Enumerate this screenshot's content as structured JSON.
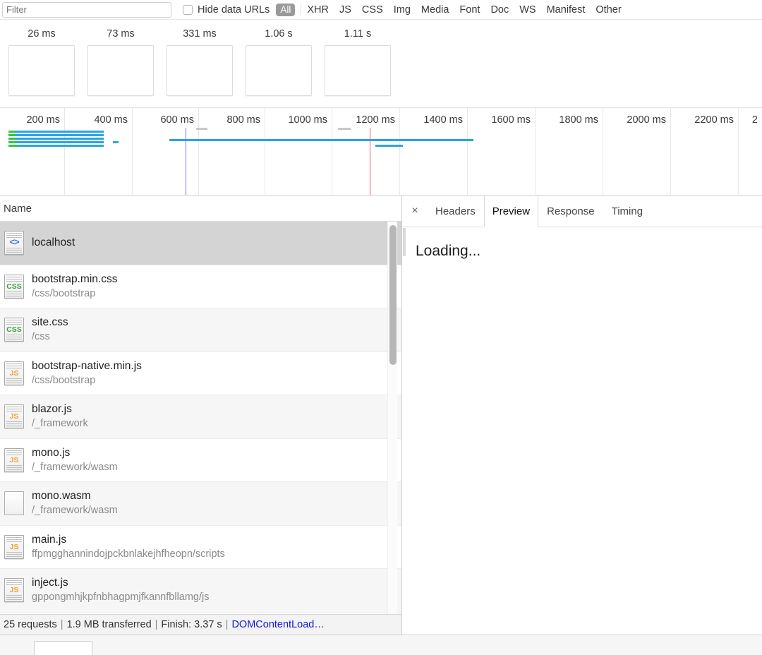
{
  "toolbar": {
    "filter_placeholder": "Filter",
    "filter_value": "",
    "hide_data_urls_label": "Hide data URLs",
    "hide_data_urls_checked": false,
    "selected_type": "All",
    "types": [
      "XHR",
      "JS",
      "CSS",
      "Img",
      "Media",
      "Font",
      "Doc",
      "WS",
      "Manifest",
      "Other"
    ]
  },
  "filmstrip": {
    "frames": [
      {
        "time": "26 ms"
      },
      {
        "time": "73 ms"
      },
      {
        "time": "331 ms"
      },
      {
        "time": "1.06 s"
      },
      {
        "time": "1.11 s"
      }
    ]
  },
  "overview": {
    "ticks": [
      "200 ms",
      "400 ms",
      "600 ms",
      "800 ms",
      "1000 ms",
      "1200 ms",
      "1400 ms",
      "1600 ms",
      "1800 ms",
      "2000 ms",
      "2200 ms",
      "2"
    ],
    "dom_content_loaded_marker": "DOMContentLoaded",
    "load_marker": "Load"
  },
  "request_table": {
    "columns": [
      "Name"
    ],
    "rows": [
      {
        "name": "localhost",
        "path": "",
        "icon": "html-document-icon",
        "selected": true
      },
      {
        "name": "bootstrap.min.css",
        "path": "/css/bootstrap",
        "icon": "css-document-icon",
        "selected": false
      },
      {
        "name": "site.css",
        "path": "/css",
        "icon": "css-document-icon",
        "selected": false
      },
      {
        "name": "bootstrap-native.min.js",
        "path": "/css/bootstrap",
        "icon": "js-document-icon",
        "selected": false
      },
      {
        "name": "blazor.js",
        "path": "/_framework",
        "icon": "js-document-icon",
        "selected": false
      },
      {
        "name": "mono.js",
        "path": "/_framework/wasm",
        "icon": "js-document-icon",
        "selected": false
      },
      {
        "name": "mono.wasm",
        "path": "/_framework/wasm",
        "icon": "blank-document-icon",
        "selected": false
      },
      {
        "name": "main.js",
        "path": "ffpmgghannindojpckbnlakejhfheopn/scripts",
        "icon": "js-document-icon",
        "selected": false
      },
      {
        "name": "inject.js",
        "path": "gppongmhjkpfnbhagpmjfkannfbllamg/js",
        "icon": "js-document-icon",
        "selected": false
      }
    ]
  },
  "statusbar": {
    "requests": "25 requests",
    "transferred": "1.9 MB transferred",
    "finish": "Finish: 3.37 s",
    "dom_content_loaded": "DOMContentLoad…",
    "separator": "|"
  },
  "details_panel": {
    "close_label": "×",
    "tabs": [
      {
        "label": "Headers",
        "active": false
      },
      {
        "label": "Preview",
        "active": true
      },
      {
        "label": "Response",
        "active": false
      },
      {
        "label": "Timing",
        "active": false
      }
    ],
    "preview_content": "Loading..."
  },
  "colors": {
    "accent_blue": "#2aa3e8",
    "ttfb_green": "#34c34a",
    "dcl_purple": "#7a6fe0",
    "load_red": "#f05a5a",
    "link_blue": "#1515e0",
    "selected_row": "#d4d4d4"
  }
}
